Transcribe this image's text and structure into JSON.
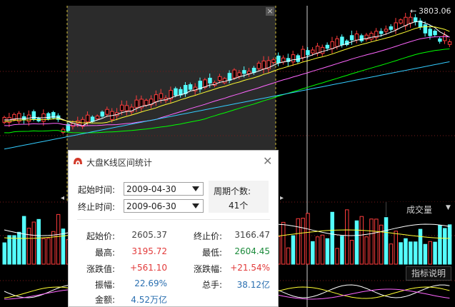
{
  "chart": {
    "high_label": "3803.06",
    "volume_selector": "成交量",
    "indicator_button": "指标说明",
    "colors": {
      "up": "#ff3c3c",
      "down": "#54ffff",
      "ma5": "#ffffff",
      "ma10": "#ffff33",
      "ma20": "#ff66ff",
      "ma30": "#00ff00",
      "ma60": "#33ccff",
      "selection": "#ffd83a"
    }
  },
  "dialog": {
    "title": "大盘K线区间统计",
    "start_time_label": "起始时间:",
    "start_time_value": "2009-04-30",
    "end_time_label": "终止时间:",
    "end_time_value": "2009-06-30",
    "period_label": "周期个数:",
    "period_count": "41个",
    "stats": {
      "start_price_label": "起始价:",
      "start_price": "2605.37",
      "end_price_label": "终止价:",
      "end_price": "3166.47",
      "high_label": "最高:",
      "high": "3195.72",
      "low_label": "最低:",
      "low": "2604.45",
      "change_value_label": "涨跌值:",
      "change_value": "+561.10",
      "change_pct_label": "涨跌幅:",
      "change_pct": "+21.54%",
      "amplitude_label": "振幅:",
      "amplitude": "22.69%",
      "total_hands_label": "总手:",
      "total_hands": "38.12亿",
      "amount_label": "金额:",
      "amount": "4.52万亿"
    }
  }
}
